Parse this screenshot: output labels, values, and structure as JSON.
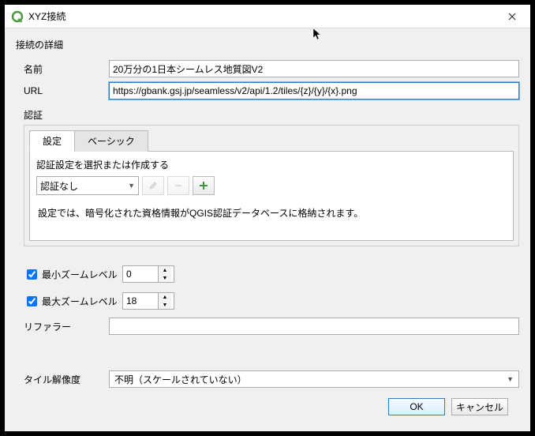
{
  "title": "XYZ接続",
  "sectionLabel": "接続の詳細",
  "name": {
    "label": "名前",
    "value": "20万分の1日本シームレス地質図V2"
  },
  "url": {
    "label": "URL",
    "value": "https://gbank.gsj.jp/seamless/v2/api/1.2/tiles/{z}/{y}/{x}.png"
  },
  "auth": {
    "label": "認証",
    "tabs": {
      "config": "設定",
      "basic": "ベーシック"
    },
    "prompt": "認証設定を選択または作成する",
    "combo": "認証なし",
    "hint": "設定では、暗号化された資格情報がQGIS認証データベースに格納されます。"
  },
  "minZoom": {
    "label": "最小ズームレベル",
    "value": "0"
  },
  "maxZoom": {
    "label": "最大ズームレベル",
    "value": "18"
  },
  "referer": {
    "label": "リファラー",
    "value": ""
  },
  "tileRes": {
    "label": "タイル解像度",
    "value": "不明（スケールされていない）"
  },
  "buttons": {
    "ok": "OK",
    "cancel": "キャンセル"
  }
}
